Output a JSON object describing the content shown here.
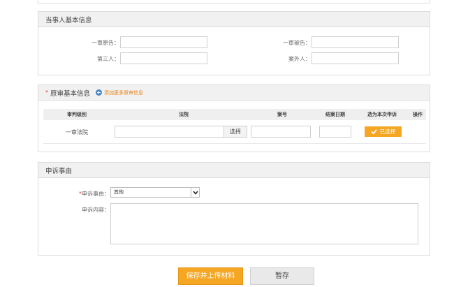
{
  "parties": {
    "title": "当事人基本信息",
    "plaintiff_label": "一审原告：",
    "defendant_label": "一审被告：",
    "third_party_label": "第三人：",
    "outsider_label": "案外人："
  },
  "original_trial": {
    "title": "原审基本信息",
    "add_link": "添加更多原审信息",
    "columns": [
      "审判级别",
      "法院",
      "案号",
      "结案日期",
      "选为本次申诉",
      "操作"
    ],
    "rows": [
      {
        "level": "一审法院",
        "court": "",
        "case_no": "",
        "closing_date": "",
        "select_label": "选择",
        "chosen_label": "已选择"
      }
    ]
  },
  "appeal": {
    "title": "申诉事由",
    "reason_label": "申诉事由：",
    "reason_value": "其他",
    "content_label": "申诉内容："
  },
  "actions": {
    "save_upload": "保存并上传材料",
    "temp_save": "暂存"
  },
  "colors": {
    "accent": "#f5a623",
    "required": "#e4393c",
    "link": "#e8841a",
    "info_icon": "#4a86c5"
  }
}
